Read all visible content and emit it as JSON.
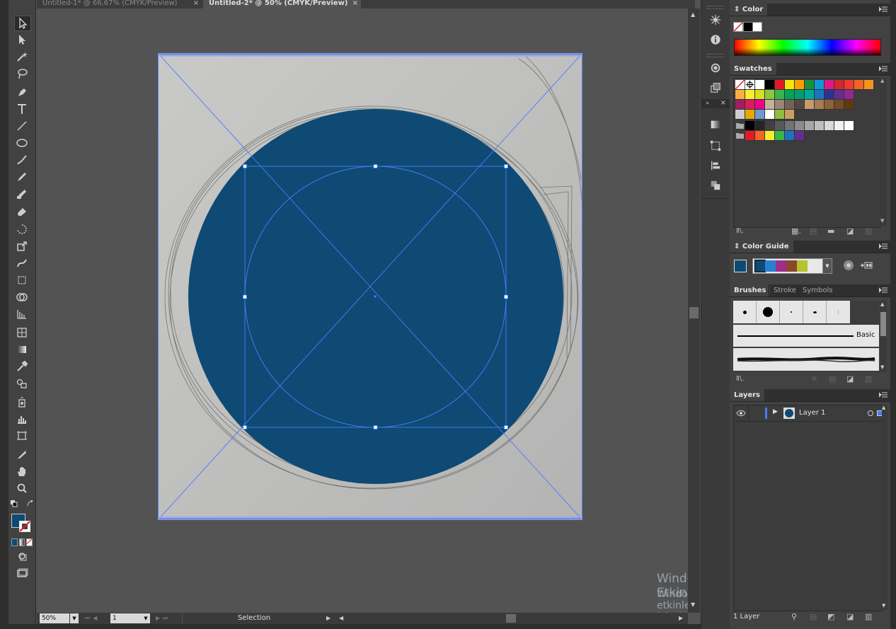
{
  "tabs": [
    {
      "label": "Untitled-1* @ 66,67% (CMYK/Preview)",
      "close": "×"
    },
    {
      "label": "Untitled-2* @ 50% (CMYK/Preview)",
      "close": "×"
    }
  ],
  "status": {
    "zoom": "50%",
    "page": "1",
    "tool_name": "Selection"
  },
  "panels": {
    "color": {
      "title": "Color"
    },
    "swatches": {
      "title": "Swatches"
    },
    "color_guide": {
      "title": "Color Guide"
    },
    "brushes": {
      "tabs": [
        "Brushes",
        "Stroke",
        "Symbols"
      ],
      "basic_label": "Basic"
    },
    "layers": {
      "title": "Layers",
      "layer_name": "Layer 1",
      "count": "1 Layer"
    }
  },
  "watermark": {
    "title": "Windows'u Etkinleştir",
    "subtitle": "Windows'u etkinleştirmek için Ayarlar'a gidin."
  },
  "colors": {
    "fill": "#0e4a73",
    "selection": "#4a7bff",
    "ui_bg": "#535353"
  },
  "swatch_rows": [
    [
      "#ffffff",
      "#000000",
      "#e01b24",
      "#f5e60a",
      "#ff9e00",
      "#1a8f3c",
      "#0f9ad6",
      "#e0198a",
      "#d6262b",
      "#ef3b2c",
      "#f26522",
      "#f7941d"
    ],
    [
      "#fbb040",
      "#f9ed32",
      "#d7df23",
      "#8dc63f",
      "#39b54a",
      "#00a651",
      "#009e72",
      "#00a99d",
      "#1b75bc",
      "#2e3192",
      "#662d91",
      "#92278f"
    ],
    [
      "#9e1f63",
      "#d91c5c",
      "#ec008c",
      "#c7b299",
      "#998675",
      "#736357",
      "#534741",
      "#c69c6d",
      "#a67c52",
      "#8c6239",
      "#754c24",
      "#603913"
    ],
    [
      "#cccccc",
      "#e6a800",
      "#6b9bd1",
      "#ffffff",
      "#8cbf3f",
      "#c8a060"
    ],
    [
      "#000000",
      "#262626",
      "#404040",
      "#595959",
      "#737373",
      "#8c8c8c",
      "#a6a6a6",
      "#bfbfbf",
      "#d9d9d9",
      "#f2f2f2",
      "#ffffff"
    ],
    [
      "#e01b24",
      "#f26522",
      "#f9ed32",
      "#39b54a",
      "#1b75bc",
      "#662d91"
    ]
  ],
  "guide_colors": [
    "#0e4a73",
    "#2a7fd4",
    "#9b2f8a",
    "#8a4a2a",
    "#b7c32a",
    "#e8e8e8"
  ]
}
